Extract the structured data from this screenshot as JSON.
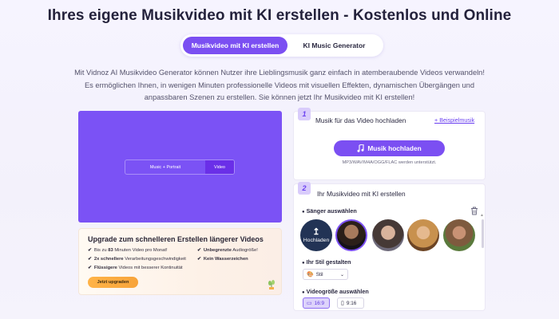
{
  "page": {
    "title": "Ihres eigene Musikvideo mit KI erstellen - Kostenlos und Online",
    "intro": "Mit Vidnoz AI Musikvideo Generator können Nutzer ihre Lieblingsmusik ganz einfach in atemberaubende Videos verwandeln! Es ermöglichen Ihnen, in wenigen Minuten professionelle Videos mit visuellen Effekten, dynamischen Übergängen und anpassbaren Szenen zu erstellen. Sie können jetzt Ihr Musikvideo mit KI erstellen!"
  },
  "tabs": {
    "active": "Musikvideo mit KI erstellen",
    "inactive": "KI Music Generator"
  },
  "preview": {
    "text": "Music + Portrait",
    "button": "Video"
  },
  "upgrade": {
    "title": "Upgrade zum schnelleren Erstellen längerer Videos",
    "features": [
      {
        "pre": "Bis zu ",
        "bold": "83",
        "post": " Minuten Video pro Monat!"
      },
      {
        "pre": "",
        "bold": "Unbegrenzte",
        "post": " Audiogröße!"
      },
      {
        "pre": "",
        "bold": "2x schnellere",
        "post": " Verarbeitungsgeschwindigkeit"
      },
      {
        "pre": "",
        "bold": "Kein Wasserzeichen",
        "post": ""
      },
      {
        "pre": "",
        "bold": "Flüssigere",
        "post": " Videos mit besserer Kontinuität"
      }
    ],
    "button": "Jetzt upgraden"
  },
  "step1": {
    "number": "1",
    "label": "Musik für das Video hochladen",
    "link": "+ Beispielmusik",
    "upload_button": "Musik hochladen",
    "formats": "MP3/WAV/M4A/OGG/FLAC werden unterstützt."
  },
  "step2": {
    "number": "2",
    "label": "Ihr Musikvideo mit KI erstellen",
    "singer_label": "Sänger auswählen",
    "upload_avatar": "Hochladen",
    "style_label": "Ihr Stil gestalten",
    "style_value": "Stil",
    "size_label": "Videogröße auswählen",
    "size_options": [
      "16:9",
      "9:16"
    ]
  },
  "colors": {
    "accent": "#7b4ff2",
    "preview_bg": "#7b52f5",
    "upgrade_button": "#ffb347"
  }
}
